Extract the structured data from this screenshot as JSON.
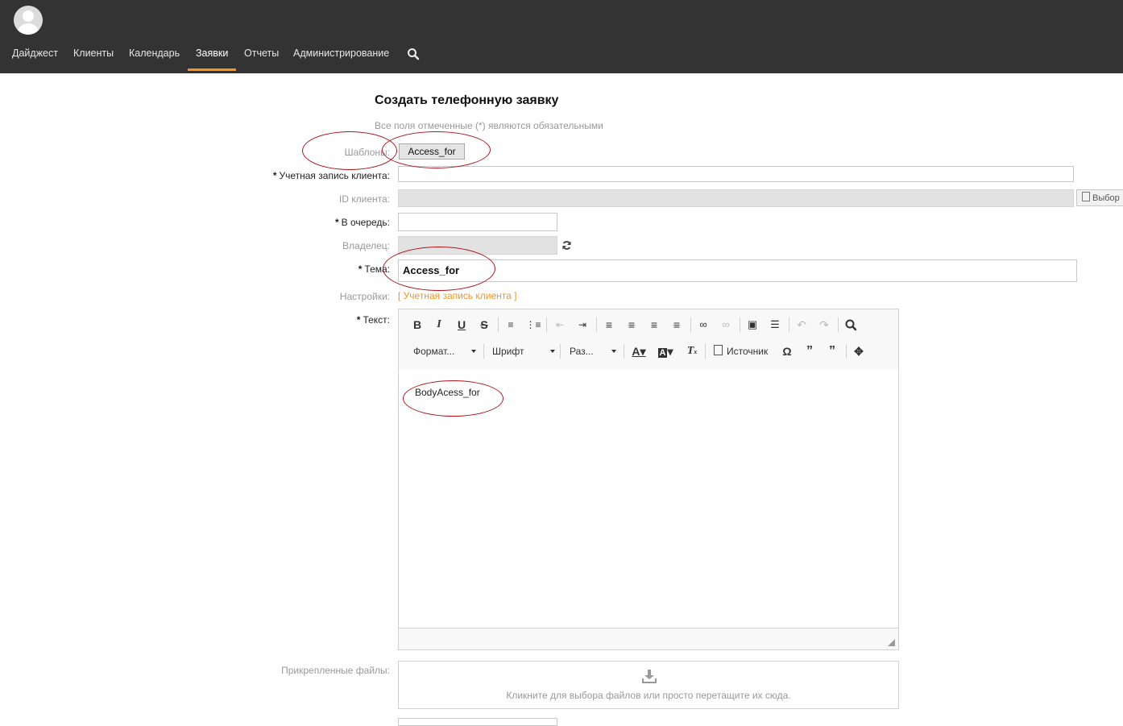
{
  "nav": {
    "items": [
      "Дайджест",
      "Клиенты",
      "Календарь",
      "Заявки",
      "Отчеты",
      "Администрирование"
    ],
    "active": "Заявки"
  },
  "form": {
    "title": "Создать телефонную заявку",
    "hint": "Все поля отмеченные (*) являются обязательными",
    "templates_label": "Шаблоны:",
    "template_button": "Access_for",
    "client_account_label": "Учетная запись клиента:",
    "client_id_label": "ID клиента:",
    "select_button": "Выбор",
    "queue_label": "В очередь:",
    "owner_label": "Владелец:",
    "subject_label": "Тема:",
    "subject_value": "Access_for",
    "settings_label": "Настройки:",
    "settings_link": "[ Учетная запись клиента ]",
    "text_label": "Текст:",
    "attachments_label": "Прикрепленные файлы:",
    "attachments_hint": "Кликните для выбора файлов или просто перетащите их сюда.",
    "required_mark": "*"
  },
  "editor": {
    "format_combo": "Формат...",
    "font_combo": "Шрифт",
    "size_combo": "Раз...",
    "source_button": "Источник",
    "body_text": "BodyAcess_for"
  },
  "colors": {
    "topbar": "#333333",
    "accent": "#f7941d",
    "annotation": "#b0141b"
  }
}
